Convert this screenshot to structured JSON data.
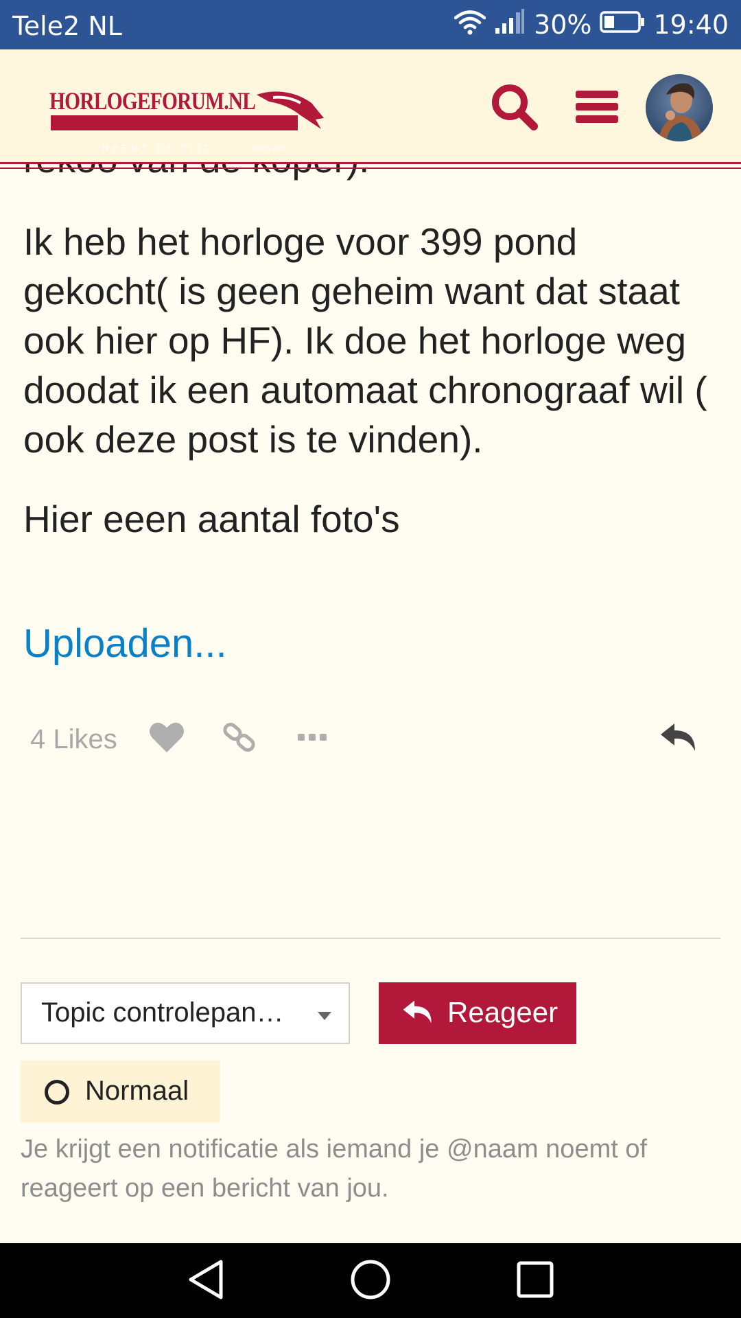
{
  "status_bar": {
    "carrier": "Tele2 NL",
    "battery": "30%",
    "battery_level": 0.3,
    "time": "19:40"
  },
  "header": {
    "logo_text": "HORLOGEFORUM.NL",
    "logo_tagline": "NEEMT DE TIJD",
    "logo_since": "SINDS 2002",
    "search_icon": "search-icon",
    "menu_icon": "hamburger-icon",
    "brand_color": "#b2183a"
  },
  "post": {
    "cut_off_line": "rekoo van de koper).",
    "paragraphs": [
      "Ik heb het horloge voor 399 pond gekocht( is geen geheim want dat staat ook hier op HF). Ik doe het horloge weg doodat ik een automaat chronograaf wil ( ook deze post is te vinden).",
      "Hier eeen aantal foto's"
    ],
    "link_text": "Uploaden...",
    "link_color": "#0a80c8",
    "likes_label": "4 Likes",
    "actions": [
      "heart-icon",
      "link-icon",
      "more-icon",
      "reply-icon"
    ]
  },
  "footer_controls": {
    "topic_select_label": "Topic controlepan…",
    "reply_button_label": "Reageer",
    "notification_level": "Normaal",
    "notification_description": "Je krijgt een notificatie als iemand je @naam noemt of reageert op een bericht van jou."
  },
  "nav_bar": {
    "buttons": [
      "back-icon",
      "home-icon",
      "recents-icon"
    ]
  }
}
